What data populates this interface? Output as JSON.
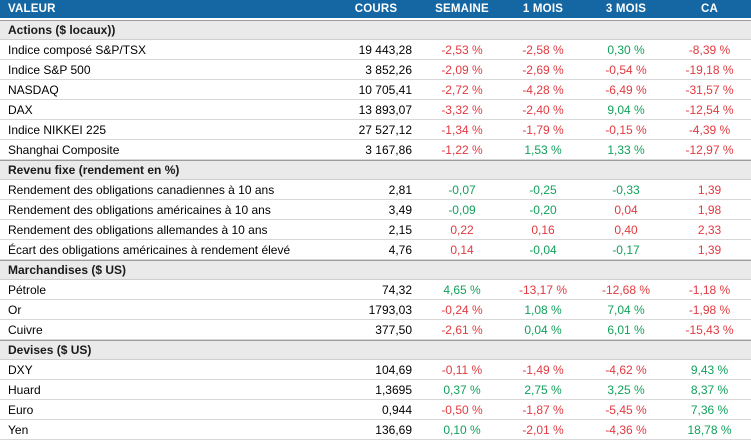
{
  "colors": {
    "header_bg": "#1567a3",
    "header_text": "#ffffff",
    "section_bg": "#eaeaea",
    "negative_value": "#e03a40",
    "positive_value": "#12a15b"
  },
  "chart_data": {
    "type": "table",
    "columns": [
      "VALEUR",
      "COURS",
      "SEMAINE",
      "1 MOIS",
      "3 MOIS",
      "CA"
    ],
    "sections": [
      {
        "title": "Actions ($ locaux))",
        "rows": [
          {
            "label": "Indice composé S&P/TSX",
            "cours": "19 443,28",
            "changes": [
              {
                "t": "-2,53 %",
                "c": "n"
              },
              {
                "t": "-2,58 %",
                "c": "n"
              },
              {
                "t": "0,30 %",
                "c": "p"
              },
              {
                "t": "-8,39 %",
                "c": "n"
              }
            ]
          },
          {
            "label": "Indice S&P 500",
            "cours": "3 852,26",
            "changes": [
              {
                "t": "-2,09 %",
                "c": "n"
              },
              {
                "t": "-2,69 %",
                "c": "n"
              },
              {
                "t": "-0,54 %",
                "c": "n"
              },
              {
                "t": "-19,18 %",
                "c": "n"
              }
            ]
          },
          {
            "label": "NASDAQ",
            "cours": "10 705,41",
            "changes": [
              {
                "t": "-2,72 %",
                "c": "n"
              },
              {
                "t": "-4,28 %",
                "c": "n"
              },
              {
                "t": "-6,49 %",
                "c": "n"
              },
              {
                "t": "-31,57 %",
                "c": "n"
              }
            ]
          },
          {
            "label": "DAX",
            "cours": "13 893,07",
            "changes": [
              {
                "t": "-3,32 %",
                "c": "n"
              },
              {
                "t": "-2,40 %",
                "c": "n"
              },
              {
                "t": "9,04 %",
                "c": "p"
              },
              {
                "t": "-12,54 %",
                "c": "n"
              }
            ]
          },
          {
            "label": "Indice NIKKEI 225",
            "cours": "27 527,12",
            "changes": [
              {
                "t": "-1,34 %",
                "c": "n"
              },
              {
                "t": "-1,79 %",
                "c": "n"
              },
              {
                "t": "-0,15 %",
                "c": "n"
              },
              {
                "t": "-4,39 %",
                "c": "n"
              }
            ]
          },
          {
            "label": "Shanghai Composite",
            "cours": "3 167,86",
            "changes": [
              {
                "t": "-1,22 %",
                "c": "n"
              },
              {
                "t": "1,53 %",
                "c": "p"
              },
              {
                "t": "1,33 %",
                "c": "p"
              },
              {
                "t": "-12,97 %",
                "c": "n"
              }
            ]
          }
        ]
      },
      {
        "title": "Revenu fixe (rendement en %)",
        "rows": [
          {
            "label": "Rendement des obligations canadiennes à 10 ans",
            "cours": "2,81",
            "changes": [
              {
                "t": "-0,07",
                "c": "p"
              },
              {
                "t": "-0,25",
                "c": "p"
              },
              {
                "t": "-0,33",
                "c": "p"
              },
              {
                "t": "1,39",
                "c": "n"
              }
            ]
          },
          {
            "label": "Rendement des obligations américaines à 10 ans",
            "cours": "3,49",
            "changes": [
              {
                "t": "-0,09",
                "c": "p"
              },
              {
                "t": "-0,20",
                "c": "p"
              },
              {
                "t": "0,04",
                "c": "n"
              },
              {
                "t": "1,98",
                "c": "n"
              }
            ]
          },
          {
            "label": "Rendement des obligations allemandes à 10 ans",
            "cours": "2,15",
            "changes": [
              {
                "t": "0,22",
                "c": "n"
              },
              {
                "t": "0,16",
                "c": "n"
              },
              {
                "t": "0,40",
                "c": "n"
              },
              {
                "t": "2,33",
                "c": "n"
              }
            ]
          },
          {
            "label": "Écart des obligations américaines à rendement élevé",
            "cours": "4,76",
            "changes": [
              {
                "t": "0,14",
                "c": "n"
              },
              {
                "t": "-0,04",
                "c": "p"
              },
              {
                "t": "-0,17",
                "c": "p"
              },
              {
                "t": "1,39",
                "c": "n"
              }
            ]
          }
        ]
      },
      {
        "title": "Marchandises ($ US)",
        "rows": [
          {
            "label": "Pétrole",
            "cours": "74,32",
            "changes": [
              {
                "t": "4,65 %",
                "c": "p"
              },
              {
                "t": "-13,17 %",
                "c": "n"
              },
              {
                "t": "-12,68 %",
                "c": "n"
              },
              {
                "t": "-1,18 %",
                "c": "n"
              }
            ]
          },
          {
            "label": "Or",
            "cours": "1793,03",
            "changes": [
              {
                "t": "-0,24 %",
                "c": "n"
              },
              {
                "t": "1,08 %",
                "c": "p"
              },
              {
                "t": "7,04 %",
                "c": "p"
              },
              {
                "t": "-1,98 %",
                "c": "n"
              }
            ]
          },
          {
            "label": "Cuivre",
            "cours": "377,50",
            "changes": [
              {
                "t": "-2,61 %",
                "c": "n"
              },
              {
                "t": "0,04 %",
                "c": "p"
              },
              {
                "t": "6,01 %",
                "c": "p"
              },
              {
                "t": "-15,43 %",
                "c": "n"
              }
            ]
          }
        ]
      },
      {
        "title": "Devises ($ US)",
        "rows": [
          {
            "label": "DXY",
            "cours": "104,69",
            "changes": [
              {
                "t": "-0,11 %",
                "c": "n"
              },
              {
                "t": "-1,49 %",
                "c": "n"
              },
              {
                "t": "-4,62 %",
                "c": "n"
              },
              {
                "t": "9,43 %",
                "c": "p"
              }
            ]
          },
          {
            "label": "Huard",
            "cours": "1,3695",
            "changes": [
              {
                "t": "0,37 %",
                "c": "p"
              },
              {
                "t": "2,75 %",
                "c": "p"
              },
              {
                "t": "3,25 %",
                "c": "p"
              },
              {
                "t": "8,37 %",
                "c": "p"
              }
            ]
          },
          {
            "label": "Euro",
            "cours": "0,944",
            "changes": [
              {
                "t": "-0,50 %",
                "c": "n"
              },
              {
                "t": "-1,87 %",
                "c": "n"
              },
              {
                "t": "-5,45 %",
                "c": "n"
              },
              {
                "t": "7,36 %",
                "c": "p"
              }
            ]
          },
          {
            "label": "Yen",
            "cours": "136,69",
            "changes": [
              {
                "t": "0,10 %",
                "c": "p"
              },
              {
                "t": "-2,01 %",
                "c": "n"
              },
              {
                "t": "-4,36 %",
                "c": "n"
              },
              {
                "t": "18,78 %",
                "c": "p"
              }
            ]
          }
        ]
      }
    ]
  }
}
